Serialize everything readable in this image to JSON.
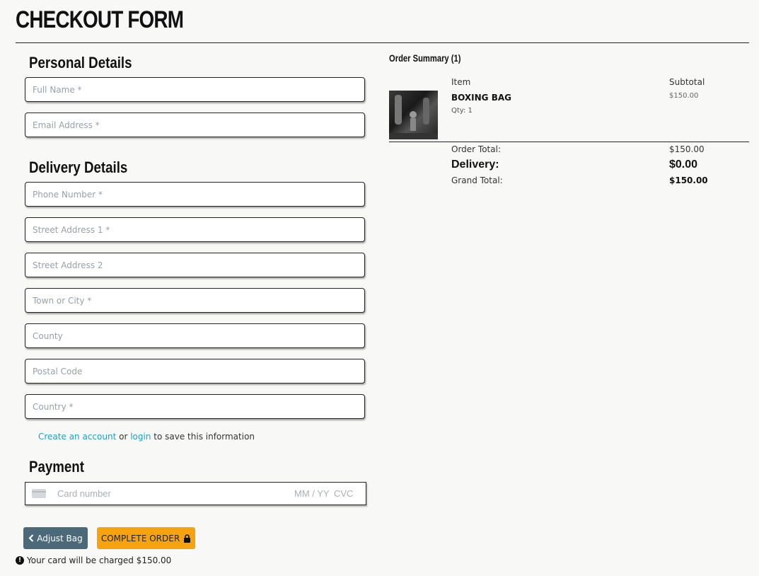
{
  "page": {
    "title": "CHECKOUT FORM"
  },
  "personal": {
    "heading": "Personal Details",
    "full_name_placeholder": "Full Name *",
    "email_placeholder": "Email Address *"
  },
  "delivery": {
    "heading": "Delivery Details",
    "phone_placeholder": "Phone Number *",
    "street1_placeholder": "Street Address 1 *",
    "street2_placeholder": "Street Address 2",
    "town_placeholder": "Town or City *",
    "county_placeholder": "County",
    "postal_placeholder": "Postal Code",
    "country_placeholder": "Country *"
  },
  "account": {
    "create_link": "Create an account",
    "or_text": "or",
    "login_link": "login",
    "suffix": "to save this information"
  },
  "payment": {
    "heading": "Payment",
    "card_number_placeholder": "Card number",
    "expiry_placeholder": "MM / YY",
    "cvc_placeholder": "CVC"
  },
  "buttons": {
    "adjust_bag": "Adjust Bag",
    "complete_order": "COMPLETE ORDER"
  },
  "charge_note": "Your card will be charged $150.00",
  "summary": {
    "title": "Order Summary (1)",
    "col_item": "Item",
    "col_subtotal": "Subtotal",
    "items": [
      {
        "name": "BOXING BAG",
        "qty": "Qty: 1",
        "subtotal": "$150.00"
      }
    ],
    "order_total_label": "Order Total:",
    "order_total_value": "$150.00",
    "delivery_label": "Delivery:",
    "delivery_value": "$0.00",
    "grand_total_label": "Grand Total:",
    "grand_total_value": "$150.00"
  },
  "colors": {
    "accent_orange": "#f7a20f",
    "adjust_button": "#4a6a7a",
    "link": "#1aa3c8"
  },
  "icons": {
    "adjust_bag": "chevron-left-icon",
    "complete_order": "lock-icon",
    "charge_note": "info-icon",
    "card": "credit-card-icon"
  }
}
